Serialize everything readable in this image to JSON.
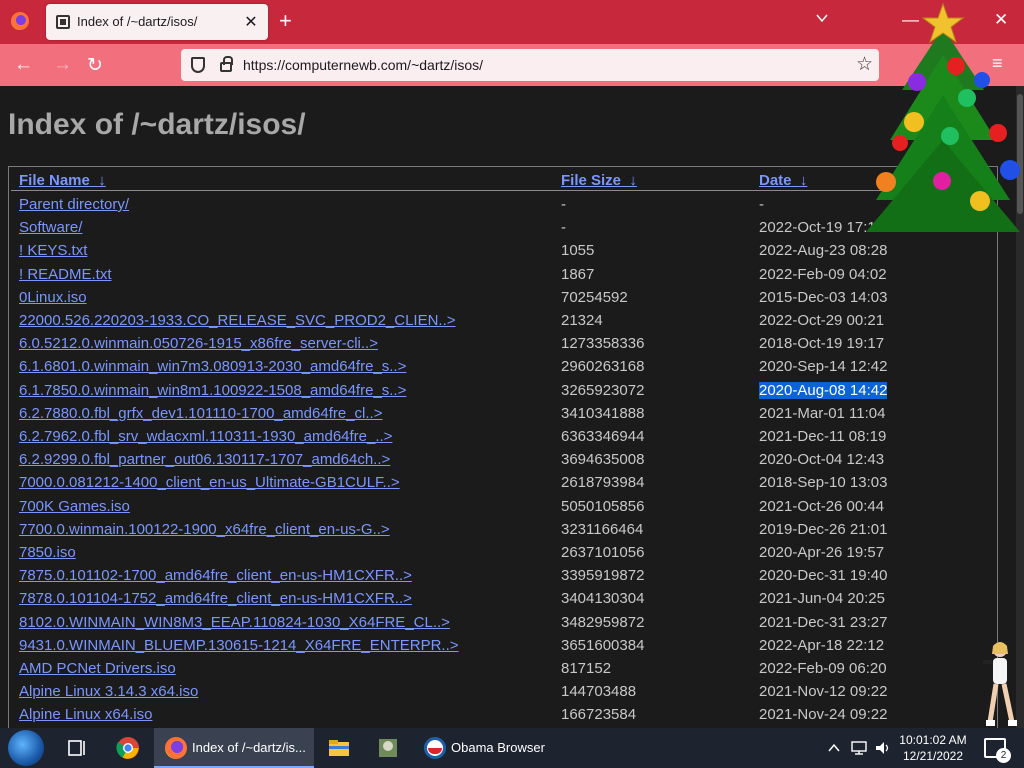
{
  "browser": {
    "tab_title": "Index of /~dartz/isos/",
    "tab_close": "✕",
    "new_tab": "+",
    "url": "https://computernewb.com/~dartz/isos/",
    "back": "←",
    "forward": "→",
    "reload": "↻",
    "minimize": "—",
    "close": "✕",
    "menu": "≡",
    "bookmark": "☆"
  },
  "page": {
    "title": "Index of /~dartz/isos/",
    "columns": {
      "name": "File Name",
      "size": "File Size",
      "date": "Date",
      "sort_indicator": "↓"
    },
    "rows": [
      {
        "name": "Parent directory/",
        "size": "-",
        "date": "-"
      },
      {
        "name": "Software/",
        "size": "-",
        "date": "2022-Oct-19 17:15"
      },
      {
        "name": "! KEYS.txt",
        "size": "1055",
        "date": "2022-Aug-23 08:28"
      },
      {
        "name": "! README.txt",
        "size": "1867",
        "date": "2022-Feb-09 04:02"
      },
      {
        "name": "0Linux.iso",
        "size": "70254592",
        "date": "2015-Dec-03 14:03"
      },
      {
        "name": "22000.526.220203-1933.CO_RELEASE_SVC_PROD2_CLIEN..>",
        "size": "21324",
        "date": "2022-Oct-29 00:21"
      },
      {
        "name": "6.0.5212.0.winmain.050726-1915_x86fre_server-cli..>",
        "size": "1273358336",
        "date": "2018-Oct-19 19:17"
      },
      {
        "name": "6.1.6801.0.winmain_win7m3.080913-2030_amd64fre_s..>",
        "size": "2960263168",
        "date": "2020-Sep-14 12:42"
      },
      {
        "name": "6.1.7850.0.winmain_win8m1.100922-1508_amd64fre_s..>",
        "size": "3265923072",
        "date": "2020-Aug-08 14:42",
        "selected": true
      },
      {
        "name": "6.2.7880.0.fbl_grfx_dev1.101110-1700_amd64fre_cl..>",
        "size": "3410341888",
        "date": "2021-Mar-01 11:04"
      },
      {
        "name": "6.2.7962.0.fbl_srv_wdacxml.110311-1930_amd64fre_..>",
        "size": "6363346944",
        "date": "2021-Dec-11 08:19"
      },
      {
        "name": "6.2.9299.0.fbl_partner_out06.130117-1707_amd64ch..>",
        "size": "3694635008",
        "date": "2020-Oct-04 12:43"
      },
      {
        "name": "7000.0.081212-1400_client_en-us_Ultimate-GB1CULF..>",
        "size": "2618793984",
        "date": "2018-Sep-10 13:03"
      },
      {
        "name": "700K Games.iso",
        "size": "5050105856",
        "date": "2021-Oct-26 00:44"
      },
      {
        "name": "7700.0.winmain.100122-1900_x64fre_client_en-us-G..>",
        "size": "3231166464",
        "date": "2019-Dec-26 21:01"
      },
      {
        "name": "7850.iso",
        "size": "2637101056",
        "date": "2020-Apr-26 19:57"
      },
      {
        "name": "7875.0.101102-1700_amd64fre_client_en-us-HM1CXFR..>",
        "size": "3395919872",
        "date": "2020-Dec-31 19:40"
      },
      {
        "name": "7878.0.101104-1752_amd64fre_client_en-us-HM1CXFR..>",
        "size": "3404130304",
        "date": "2021-Jun-04 20:25"
      },
      {
        "name": "8102.0.WINMAIN_WIN8M3_EEAP.110824-1030_X64FRE_CL..>",
        "size": "3482959872",
        "date": "2021-Dec-31 23:27"
      },
      {
        "name": "9431.0.WINMAIN_BLUEMP.130615-1214_X64FRE_ENTERPR..>",
        "size": "3651600384",
        "date": "2022-Apr-18 22:12"
      },
      {
        "name": "AMD PCNet Drivers.iso",
        "size": "817152",
        "date": "2022-Feb-09 06:20"
      },
      {
        "name": "Alpine Linux 3.14.3 x64.iso",
        "size": "144703488",
        "date": "2021-Nov-12 09:22"
      },
      {
        "name": "Alpine Linux x64.iso",
        "size": "166723584",
        "date": "2021-Nov-24 09:22"
      }
    ]
  },
  "taskbar": {
    "firefox_label": "Index of /~dartz/is...",
    "obama_label": "Obama Browser",
    "time": "10:01:02 AM",
    "date": "12/21/2022",
    "notification_count": "2"
  },
  "colors": {
    "tab_strip": "#c7283b",
    "nav_bar": "#f26f7d",
    "link": "#7b96ff",
    "selection": "#0a63d8"
  }
}
